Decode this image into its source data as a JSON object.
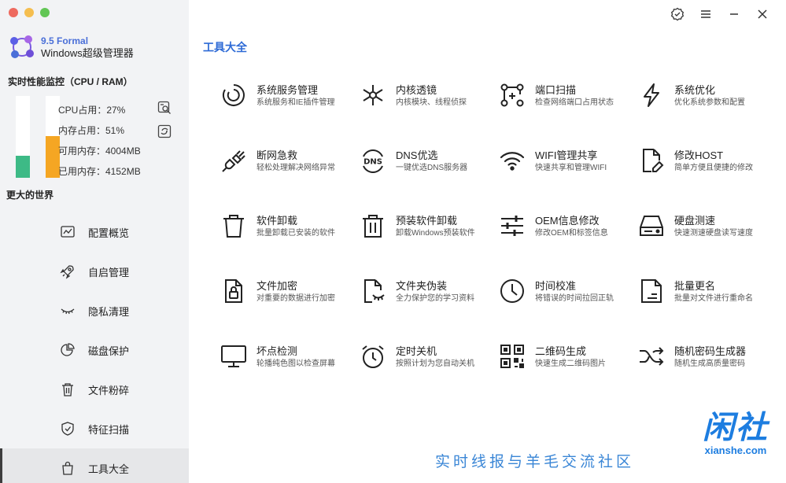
{
  "window": {
    "controls": [
      "verified-icon",
      "menu-icon",
      "minimize-icon",
      "close-icon"
    ]
  },
  "brand": {
    "version": "9.5 Formal",
    "name": "Windows超级管理器"
  },
  "perf": {
    "title": "实时性能监控（CPU / RAM）",
    "cpu_label": "CPU占用：27%",
    "mem_label": "内存占用：51%",
    "avail_label": "可用内存：4004MB",
    "used_label": "已用内存：4152MB",
    "cpu_percent": 27,
    "mem_percent": 51,
    "cpu_color": "#3dba86",
    "mem_color": "#f5a623"
  },
  "slogan": "更大的世界",
  "nav": [
    {
      "label": "配置概览",
      "icon": "chart-icon"
    },
    {
      "label": "自启管理",
      "icon": "rocket-icon"
    },
    {
      "label": "隐私清理",
      "icon": "eye-closed-icon"
    },
    {
      "label": "磁盘保护",
      "icon": "pie-icon"
    },
    {
      "label": "文件粉碎",
      "icon": "trash-icon"
    },
    {
      "label": "特征扫描",
      "icon": "shield-icon"
    },
    {
      "label": "工具大全",
      "icon": "bag-icon",
      "active": true
    }
  ],
  "page_title": "工具大全",
  "tools": [
    {
      "name": "系统服务管理",
      "desc": "系统服务和IE插件管理",
      "icon": "service-icon"
    },
    {
      "name": "内核透镜",
      "desc": "内核模块、线程侦探",
      "icon": "kernel-icon"
    },
    {
      "name": "端口扫描",
      "desc": "检查网络端口占用状态",
      "icon": "port-icon"
    },
    {
      "name": "系统优化",
      "desc": "优化系统参数和配置",
      "icon": "lightning-icon"
    },
    {
      "name": "断网急救",
      "desc": "轻松处理解决网络异常",
      "icon": "plug-icon"
    },
    {
      "name": "DNS优选",
      "desc": "一键优选DNS服务器",
      "icon": "dns-icon"
    },
    {
      "name": "WIFI管理共享",
      "desc": "快速共享和管理WIFI",
      "icon": "wifi-icon"
    },
    {
      "name": "修改HOST",
      "desc": "简单方便且便捷的修改",
      "icon": "edit-file-icon"
    },
    {
      "name": "软件卸载",
      "desc": "批量卸载已安装的软件",
      "icon": "bin-icon"
    },
    {
      "name": "预装软件卸载",
      "desc": "卸载Windows预装软件",
      "icon": "bin-lines-icon"
    },
    {
      "name": "OEM信息修改",
      "desc": "修改OEM和标签信息",
      "icon": "sliders-icon"
    },
    {
      "name": "硬盘测速",
      "desc": "快速测速硬盘读写速度",
      "icon": "disk-icon"
    },
    {
      "name": "文件加密",
      "desc": "对重要的数据进行加密",
      "icon": "lock-file-icon"
    },
    {
      "name": "文件夹伪装",
      "desc": "全力保护您的学习资料",
      "icon": "mask-file-icon"
    },
    {
      "name": "时间校准",
      "desc": "将错误的时间拉回正轨",
      "icon": "clock-icon"
    },
    {
      "name": "批量更名",
      "desc": "批量对文件进行重命名",
      "icon": "rename-file-icon"
    },
    {
      "name": "坏点检测",
      "desc": "轮播纯色图以检查屏幕",
      "icon": "monitor-icon"
    },
    {
      "name": "定时关机",
      "desc": "按照计划为您自动关机",
      "icon": "alarm-icon"
    },
    {
      "name": "二维码生成",
      "desc": "快速生成二维码图片",
      "icon": "qrcode-icon"
    },
    {
      "name": "随机密码生成器",
      "desc": "随机生成高质量密码",
      "icon": "shuffle-icon"
    }
  ],
  "watermark": {
    "text": "实时线报与羊毛交流社区",
    "logo_cn": "闲社",
    "logo_en": "xianshe.com"
  }
}
